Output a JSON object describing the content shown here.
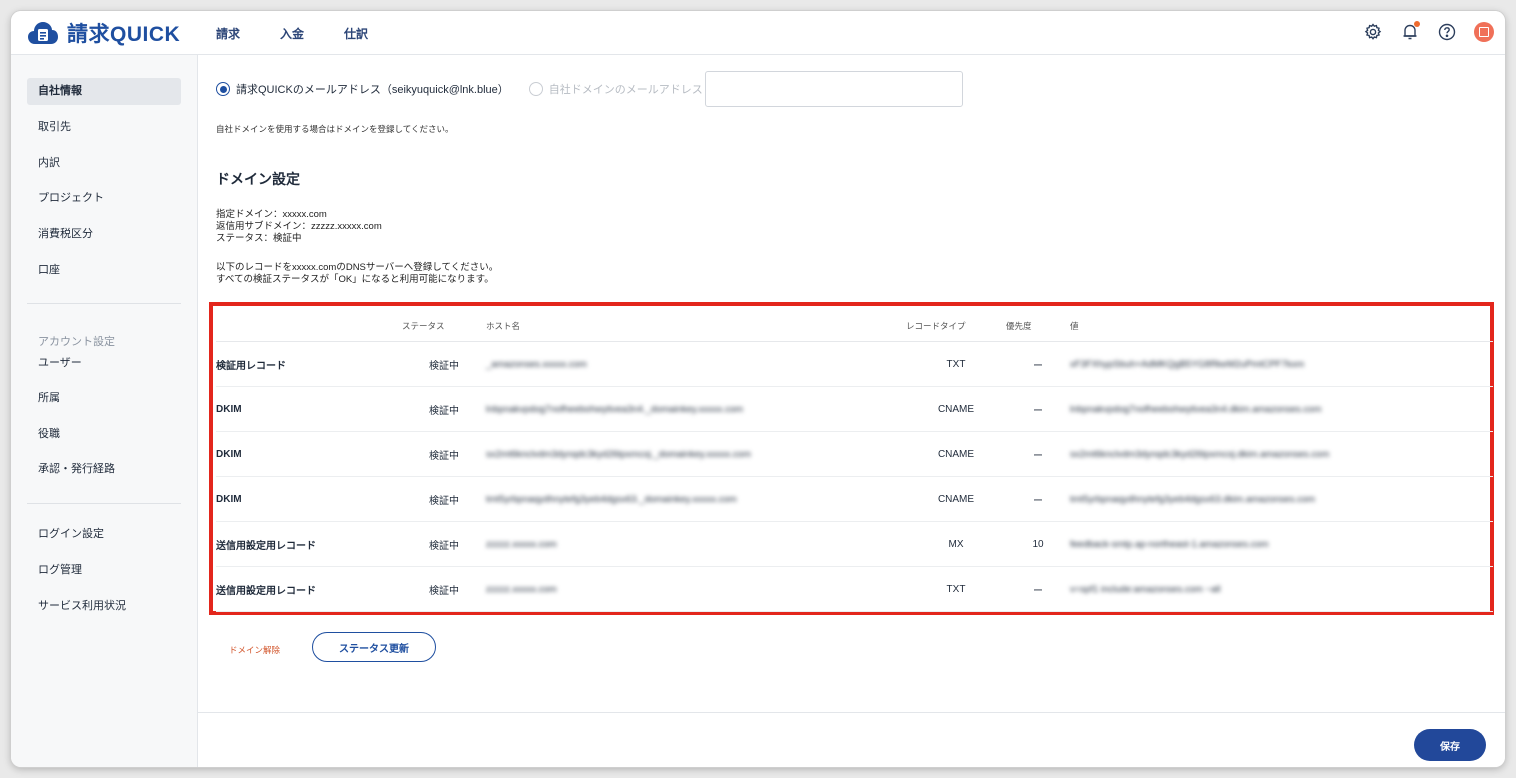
{
  "app": {
    "name": "請求QUICK"
  },
  "topnav": [
    "請求",
    "入金",
    "仕訳"
  ],
  "topicons": [
    "gear-icon",
    "bell-icon",
    "help-icon",
    "avatar"
  ],
  "colors": {
    "brand": "#1f4fa0",
    "highlight": "#e3261c",
    "danger_link": "#d2542a",
    "notification": "#ef6b2e",
    "avatar": "#f07058"
  },
  "sidebar": {
    "group1": [
      "自社情報",
      "取引先",
      "内訳",
      "プロジェクト",
      "消費税区分",
      "口座"
    ],
    "account_heading": "アカウント設定",
    "group2": [
      "ユーザー",
      "所属",
      "役職",
      "承認・発行経路"
    ],
    "group3": [
      "ログイン設定",
      "ログ管理",
      "サービス利用状況"
    ]
  },
  "email": {
    "option_quick": "請求QUICKのメールアドレス（seikyuquick@lnk.blue）",
    "option_own": "自社ドメインのメールアドレス",
    "note": "自社ドメインを使用する場合はドメインを登録してください。"
  },
  "domain": {
    "heading": "ドメイン設定",
    "line1": "指定ドメイン：xxxxx.com",
    "line2": "返信用サブドメイン：zzzzz.xxxxx.com",
    "line3": "ステータス：検証中",
    "line4": "以下のレコードをxxxxx.comのDNSサーバーへ登録してください。",
    "line5": "すべての検証ステータスが「OK」になると利用可能になります。"
  },
  "table": {
    "headers": [
      "",
      "ステータス",
      "ホスト名",
      "レコードタイプ",
      "優先度",
      "値"
    ],
    "rows": [
      [
        "検証用レコード",
        "検証中",
        "_amazonses.xxxxx.com",
        "TXT",
        "ー",
        "xF3FXhypSbuh+AdMKQgB5YG8RkeM2uPmtCPF7kxm"
      ],
      [
        "DKIM",
        "検証中",
        "lnbpnakvpdog7nofheebohwytivea3n4._domainkey.xxxxx.com",
        "CNAME",
        "ー",
        "lnbpnakvpdog7nofheebohwytivea3n4.dkim.amazonses.com"
      ],
      [
        "DKIM",
        "検証中",
        "sx2mt6knclvdm3dynqdc3kyd26tpxmcoj._domainkey.xxxxx.com",
        "CNAME",
        "ー",
        "sx2mt6knclvdm3dynqdc3kyd26tpxmcoj.dkim.amazonses.com"
      ],
      [
        "DKIM",
        "検証中",
        "tmt5yrbpnaqydhnytefg3yeb4dgsx63._domainkey.xxxxx.com",
        "CNAME",
        "ー",
        "tmt5yrbpnaqydhnytefg3yeb4dgsx63.dkim.amazonses.com"
      ],
      [
        "送信用設定用レコード",
        "検証中",
        "zzzzz.xxxxx.com",
        "MX",
        "10",
        "feedback-smtp.ap-northeast-1.amazonses.com"
      ],
      [
        "送信用設定用レコード",
        "検証中",
        "zzzzz.xxxxx.com",
        "TXT",
        "ー",
        "v=spf1 include:amazonses.com ~all"
      ]
    ]
  },
  "actions": {
    "release": "ドメイン解除",
    "update": "ステータス更新",
    "save": "保存"
  }
}
